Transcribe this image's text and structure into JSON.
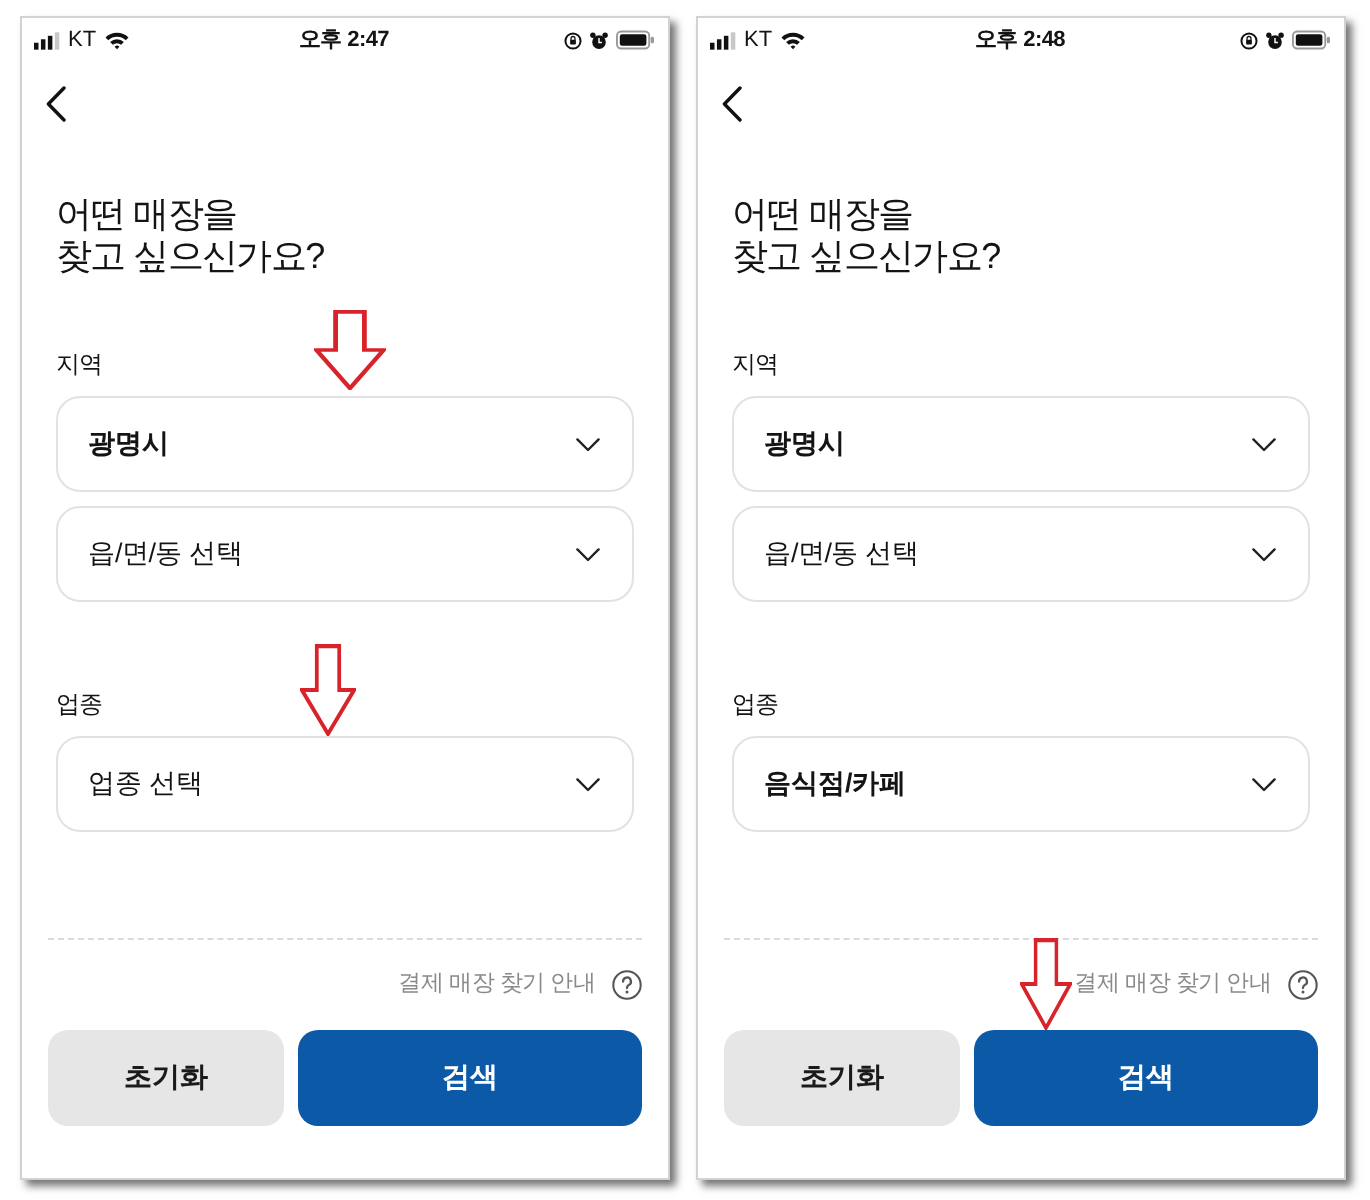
{
  "screens": [
    {
      "status_bar": {
        "carrier": "KT",
        "time": "오후 2:47"
      },
      "title": "어떤 매장을\n찾고 싶으신가요?",
      "sections": [
        {
          "label": "지역",
          "selects": [
            {
              "value": "광명시",
              "marked_by_arrow": true
            },
            {
              "placeholder": "읍/면/동 선택",
              "marked_by_arrow": false
            }
          ]
        },
        {
          "label": "업종",
          "selects": [
            {
              "placeholder": "업종 선택",
              "marked_by_arrow": true
            }
          ]
        }
      ],
      "help_link": "결제 매장 찾기 안내",
      "buttons": [
        {
          "label": "초기화",
          "kind": "secondary",
          "marked_by_arrow": false
        },
        {
          "label": "검색",
          "kind": "primary",
          "marked_by_arrow": false
        }
      ]
    },
    {
      "status_bar": {
        "carrier": "KT",
        "time": "오후 2:48"
      },
      "title": "어떤 매장을\n찾고 싶으신가요?",
      "sections": [
        {
          "label": "지역",
          "selects": [
            {
              "value": "광명시",
              "marked_by_arrow": false
            },
            {
              "placeholder": "읍/면/동 선택",
              "marked_by_arrow": false
            }
          ]
        },
        {
          "label": "업종",
          "selects": [
            {
              "value": "음식점/카페",
              "marked_by_arrow": false
            }
          ]
        }
      ],
      "help_link": "결제 매장 찾기 안내",
      "buttons": [
        {
          "label": "초기화",
          "kind": "secondary",
          "marked_by_arrow": false
        },
        {
          "label": "검색",
          "kind": "primary",
          "marked_by_arrow": true
        }
      ]
    }
  ]
}
